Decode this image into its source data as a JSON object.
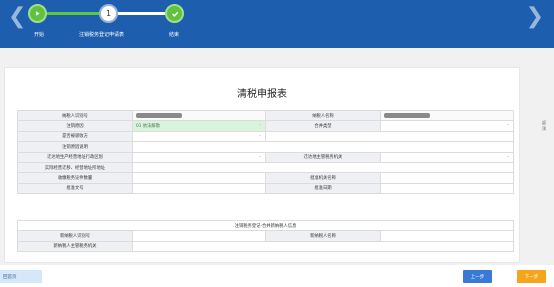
{
  "steps": [
    {
      "label": "开始",
      "status": "done"
    },
    {
      "label": "注销税务登记申请表",
      "status": "current",
      "number": "1"
    },
    {
      "label": "结束",
      "status": "done"
    }
  ],
  "form": {
    "title": "清税申报表",
    "rows": {
      "taxpayer_id_label": "纳税人识别号",
      "taxpayer_name_label": "纳税人名称",
      "reason_label": "注销原因",
      "reason_value": "01 依法解散",
      "merge_type_label": "合并类型",
      "outstanding_tax_label": "是否被吸收方",
      "reason_desc_label": "注销原因说明",
      "admin_region_label": "迁达地生产经营地址行政区划",
      "tax_office_label": "迁达地主管税务机关",
      "contact_label": "实际经营迁移、经营地址所地址",
      "cert_count_label": "收缴税务证件数量",
      "approver_label": "批准机关名称",
      "doc_no_label": "批准文号",
      "approve_date_label": "批准日期"
    },
    "merge": {
      "header": "注销税务登记-合并新纳税人信息",
      "new_taxpayer_id_label": "新纳税人识别号",
      "new_taxpayer_name_label": "新纳税人名称",
      "new_tax_office_label": "新纳税人主管税务机关"
    }
  },
  "buttons": {
    "back_home": "回首页",
    "prev": "上一步",
    "next": "下一步"
  },
  "side_text": [
    "返",
    "顶"
  ],
  "colors": {
    "header_bg": "#1d5fae",
    "step_green": "#62c23f",
    "prev_btn": "#3b79d6",
    "next_btn": "#f4a51d"
  }
}
